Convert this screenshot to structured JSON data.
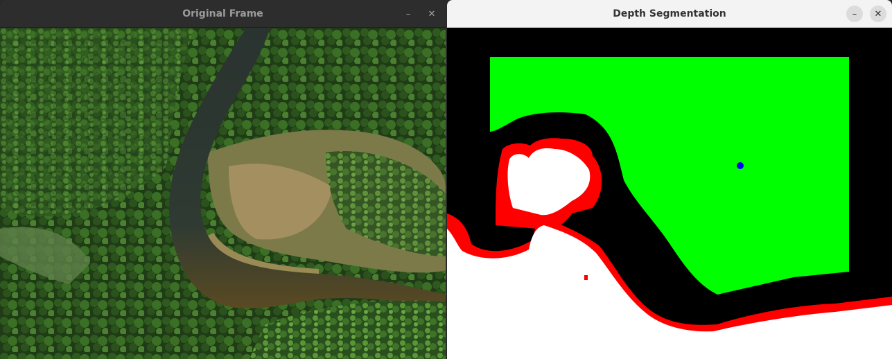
{
  "windows": {
    "left": {
      "title": "Original Frame",
      "minimize_glyph": "–",
      "close_glyph": "✕"
    },
    "right": {
      "title": "Depth Segmentation",
      "minimize_glyph": "–",
      "close_glyph": "✕"
    }
  },
  "colors": {
    "segment_green": "#00ff00",
    "segment_red": "#ff0000",
    "segment_white": "#ffffff",
    "segment_black": "#000000",
    "marker_blue": "#0000ff"
  }
}
